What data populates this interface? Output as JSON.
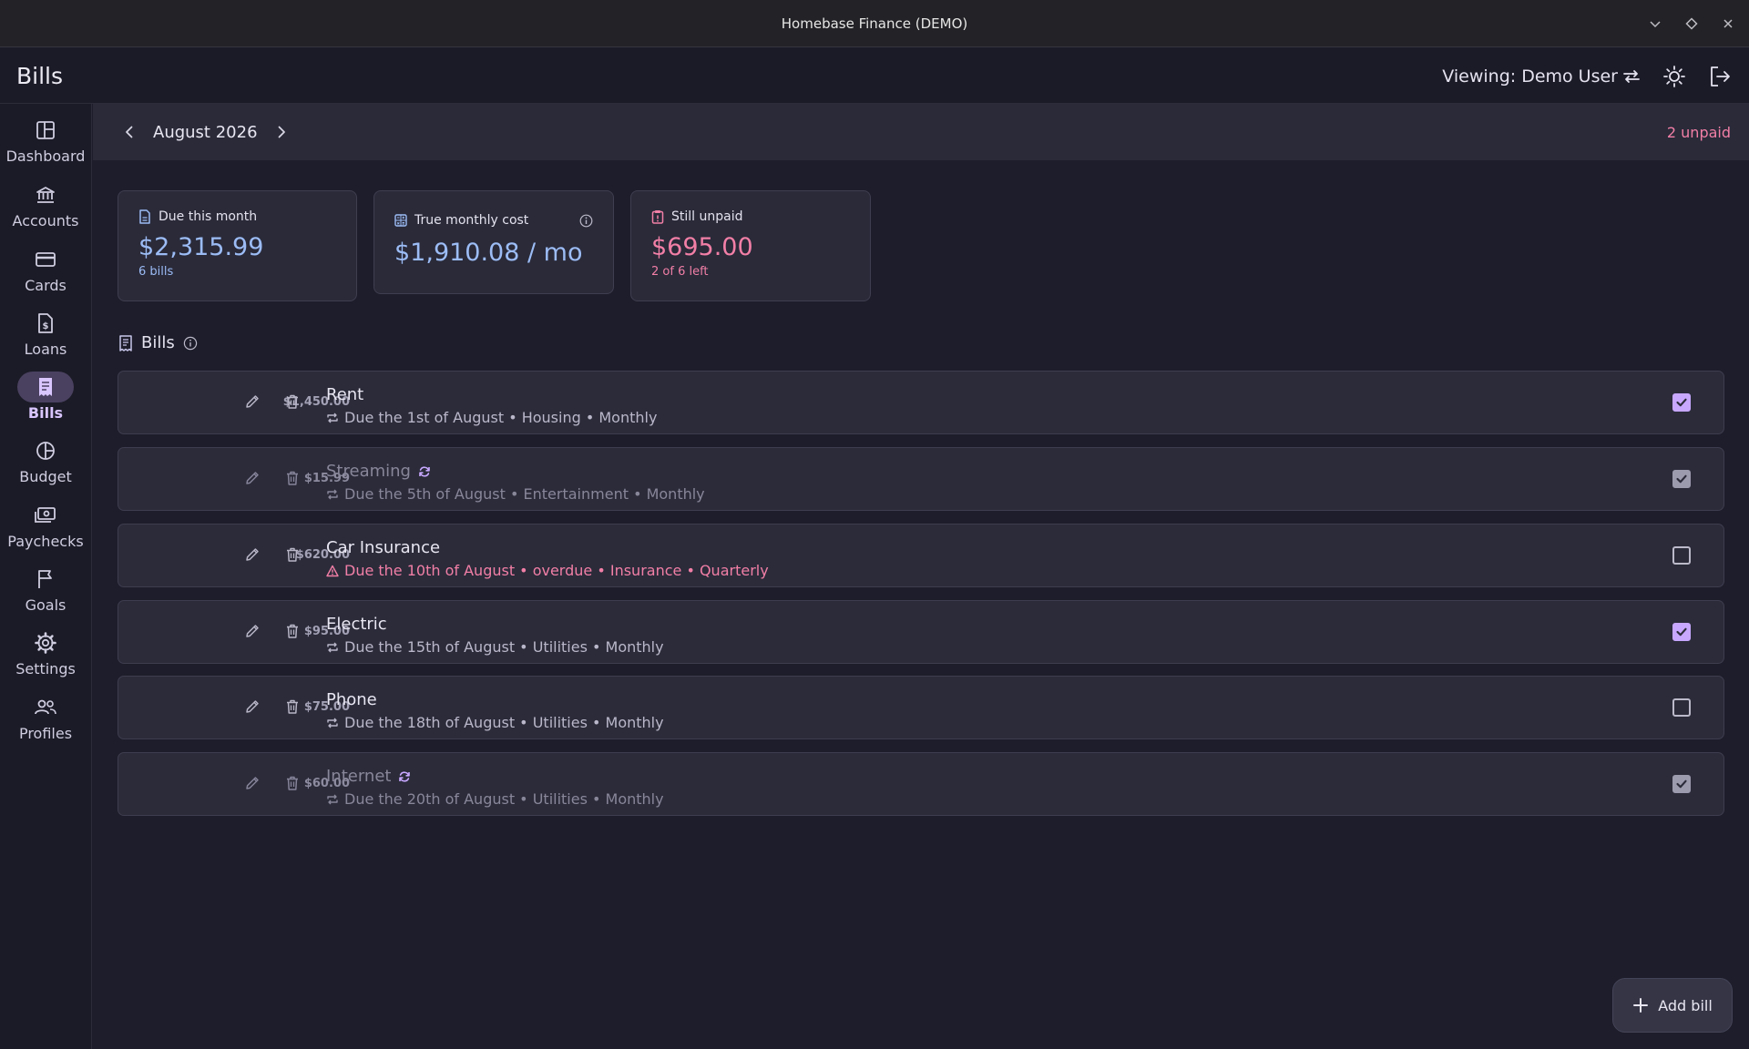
{
  "window": {
    "title": "Homebase Finance (DEMO)"
  },
  "header": {
    "title": "Bills",
    "viewing": "Viewing: Demo User"
  },
  "sidebar": {
    "items": [
      {
        "label": "Dashboard",
        "icon": "dashboard-icon"
      },
      {
        "label": "Accounts",
        "icon": "bank-icon"
      },
      {
        "label": "Cards",
        "icon": "credit-card-icon"
      },
      {
        "label": "Loans",
        "icon": "dollar-document-icon"
      },
      {
        "label": "Bills",
        "icon": "receipt-icon",
        "active": true
      },
      {
        "label": "Budget",
        "icon": "pie-chart-icon"
      },
      {
        "label": "Paychecks",
        "icon": "cash-icon"
      },
      {
        "label": "Goals",
        "icon": "flag-icon"
      },
      {
        "label": "Settings",
        "icon": "gear-icon"
      },
      {
        "label": "Profiles",
        "icon": "people-icon"
      }
    ]
  },
  "month_bar": {
    "month": "August 2026",
    "unpaid": "2 unpaid"
  },
  "stats": {
    "due": {
      "label": "Due this month",
      "value": "$2,315.99",
      "sub": "6 bills"
    },
    "true_cost": {
      "label": "True monthly cost",
      "value": "$1,910.08 / mo"
    },
    "unpaid": {
      "label": "Still unpaid",
      "value": "$695.00",
      "sub": "2 of 6 left"
    }
  },
  "bills_section": {
    "title": "Bills"
  },
  "bills": [
    {
      "amount": "$1,450.00",
      "name": "Rent",
      "meta": "Due the 1st of August • Housing • Monthly",
      "paid": true,
      "auto": false,
      "overdue": false
    },
    {
      "amount": "$15.99",
      "name": "Streaming",
      "meta": "Due the 5th of August • Entertainment • Monthly",
      "paid": true,
      "auto": true,
      "overdue": false
    },
    {
      "amount": "$620.00",
      "name": "Car Insurance",
      "meta": "Due the 10th of August • overdue • Insurance • Quarterly",
      "paid": false,
      "auto": false,
      "overdue": true
    },
    {
      "amount": "$95.00",
      "name": "Electric",
      "meta": "Due the 15th of August • Utilities • Monthly",
      "paid": true,
      "auto": false,
      "overdue": false
    },
    {
      "amount": "$75.00",
      "name": "Phone",
      "meta": "Due the 18th of August • Utilities • Monthly",
      "paid": false,
      "auto": false,
      "overdue": false
    },
    {
      "amount": "$60.00",
      "name": "Internet",
      "meta": "Due the 20th of August • Utilities • Monthly",
      "paid": true,
      "auto": true,
      "overdue": false
    }
  ],
  "fab": {
    "label": "Add bill"
  },
  "colors": {
    "accent": "#c8a8ff",
    "blue": "#9cbcf5",
    "pink": "#f27fa6",
    "background": "#1d1d2b",
    "surface": "#2b2b3a"
  }
}
